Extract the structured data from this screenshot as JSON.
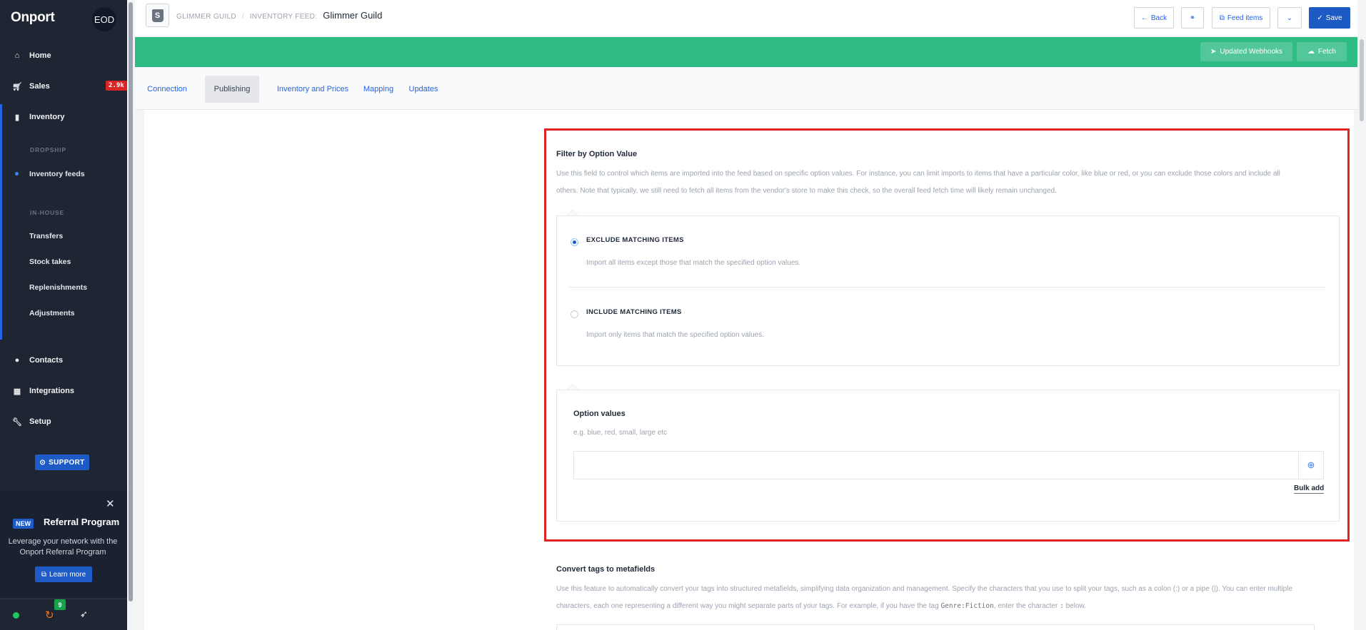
{
  "sidebar": {
    "brand": "Onport",
    "user_initials": "EOD",
    "nav": {
      "home": "Home",
      "sales": "Sales",
      "sales_badge": "2.9k",
      "inventory": "Inventory",
      "dropship_section": "DROPSHIP",
      "inventory_feeds": "Inventory feeds",
      "inhouse_section": "IN-HOUSE",
      "transfers": "Transfers",
      "stock_takes": "Stock takes",
      "replenishments": "Replenishments",
      "adjustments": "Adjustments",
      "contacts": "Contacts",
      "integrations": "Integrations",
      "setup": "Setup"
    },
    "support_label": "SUPPORT",
    "referral": {
      "new_badge": "NEW",
      "title": "Referral Program",
      "description": "Leverage your network with the Onport Referral Program",
      "button": "Learn more"
    },
    "footer": {
      "notification_count": "9"
    }
  },
  "header": {
    "breadcrumb_store": "GLIMMER GUILD",
    "breadcrumb_sep": "/",
    "breadcrumb_prefix": "INVENTORY FEED:",
    "title": "Glimmer Guild",
    "buttons": {
      "back": "Back",
      "feed_items": "Feed items",
      "save": "Save"
    }
  },
  "band": {
    "updated_webhooks": "Updated Webhooks",
    "fetch": "Fetch"
  },
  "tabs": [
    "Connection",
    "Publishing",
    "Inventory and Prices",
    "Mapping",
    "Updates"
  ],
  "filter": {
    "title": "Filter by Option Value",
    "description_line1": "Use this field to control which items are imported into the feed based on specific option values. For instance, you can limit imports to items that have a particular color, like blue or red, or you can exclude those colors and include all",
    "description_line2": "others. Note that typically, we still need to fetch all items from the vendor's store to make this check, so the overall feed fetch time will likely remain unchanged.",
    "exclude": {
      "label": "EXCLUDE MATCHING ITEMS",
      "description": "Import all items except those that match the specified option values.",
      "selected": true
    },
    "include": {
      "label": "INCLUDE MATCHING ITEMS",
      "description": "Import only items that match the specified option values.",
      "selected": false
    },
    "option_values": {
      "title": "Option values",
      "hint": "e.g. blue, red, small, large etc",
      "input_value": "",
      "bulk_add": "Bulk add"
    }
  },
  "convert_tags": {
    "title": "Convert tags to metafields",
    "description_line1": "Use this feature to automatically convert your tags into structured metafields, simplifying data organization and management. Specify the characters that you use to split your tags, such as a colon (:) or a pipe (|). You can enter multiple",
    "description_line2_a": "characters, each one representing a different way you might separate parts of your tags. For example, if you have the tag",
    "description_code1": "Genre:Fiction",
    "description_line2_b": ", enter the character",
    "description_code2": ":",
    "description_line2_c": "below."
  },
  "colors": {
    "accent": "#1d5bc4",
    "green_band": "#2fbb84",
    "sidebar": "#1e2533",
    "highlight": "#e02424"
  }
}
